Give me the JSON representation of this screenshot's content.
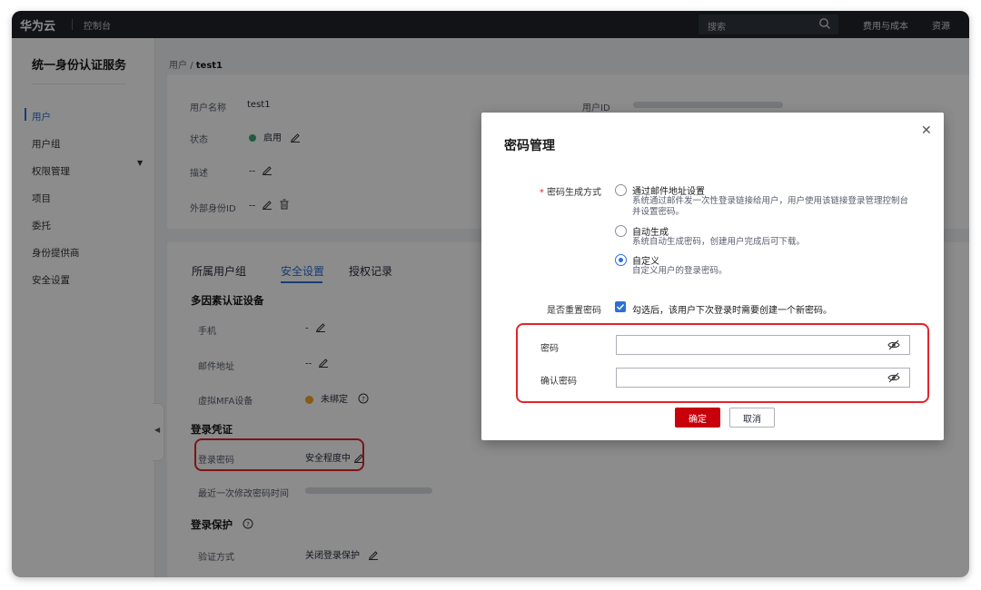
{
  "topbar": {
    "brand": "华为云",
    "console": "控制台",
    "search_placeholder": "搜索",
    "link_billing": "费用与成本",
    "link_resources": "资源"
  },
  "sidebar": {
    "title": "统一身份认证服务",
    "items": [
      {
        "label": "用户",
        "active": true
      },
      {
        "label": "用户组"
      },
      {
        "label": "权限管理"
      },
      {
        "label": "项目"
      },
      {
        "label": "委托"
      },
      {
        "label": "身份提供商"
      },
      {
        "label": "安全设置"
      }
    ]
  },
  "breadcrumb": {
    "root": "用户",
    "sep": "/",
    "current": "test1"
  },
  "user_info": {
    "username_label": "用户名称",
    "username": "test1",
    "userid_label": "用户ID",
    "status_label": "状态",
    "status": "启用",
    "desc_label": "描述",
    "desc": "--",
    "external_id_label": "外部身份ID",
    "external_id": "--"
  },
  "tabs": [
    "所属用户组",
    "安全设置",
    "授权记录"
  ],
  "security": {
    "mfa_title": "多因素认证设备",
    "phone_label": "手机",
    "phone_value": "-",
    "email_label": "邮件地址",
    "email_value": "--",
    "vmfa_label": "虚拟MFA设备",
    "vmfa_value": "未绑定",
    "cred_title": "登录凭证",
    "password_label": "登录密码",
    "password_value": "安全程度中",
    "last_change_label": "最近一次修改密码时间",
    "protect_title": "登录保护",
    "verify_label": "验证方式",
    "verify_value": "关闭登录保护"
  },
  "dialog": {
    "title": "密码管理",
    "gen_method_label": "密码生成方式",
    "options": [
      {
        "title": "通过邮件地址设置",
        "desc1": "系统通过邮件发一次性登录链接给用户，用户使用该链接登录管理控制台",
        "desc2": "并设置密码。",
        "selected": false
      },
      {
        "title": "自动生成",
        "desc1": "系统自动生成密码，创建用户完成后可下载。",
        "selected": false
      },
      {
        "title": "自定义",
        "desc1": "自定义用户的登录密码。",
        "selected": true
      }
    ],
    "reset_label": "是否重置密码",
    "reset_text": "勾选后，该用户下次登录时需要创建一个新密码。",
    "password_label": "密码",
    "confirm_label": "确认密码",
    "ok": "确定",
    "cancel": "取消"
  },
  "colors": {
    "accent": "#2c6fd6",
    "brand_red": "#c7000b",
    "highlight": "#e3242b"
  }
}
